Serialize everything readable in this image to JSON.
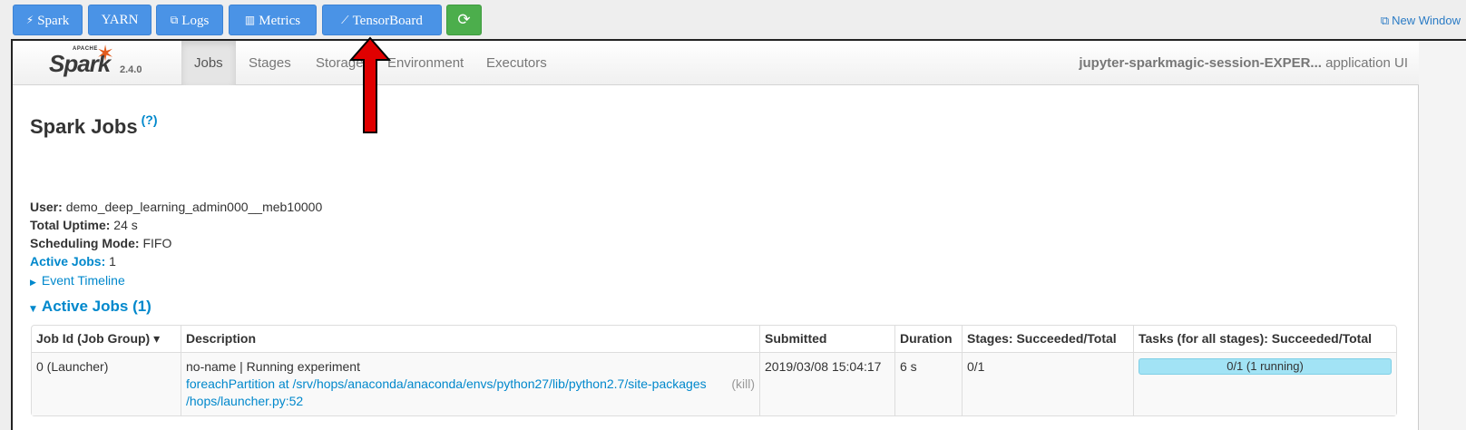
{
  "toolbar": {
    "buttons": [
      {
        "label": "Spark",
        "icon": "bolt-icon"
      },
      {
        "label": "YARN",
        "icon": ""
      },
      {
        "label": "Logs",
        "icon": "copy-icon"
      },
      {
        "label": "Metrics",
        "icon": "bar-chart-icon"
      },
      {
        "label": "TensorBoard",
        "icon": "line-chart-icon"
      },
      {
        "label": "",
        "icon": "refresh-icon"
      }
    ],
    "new_window": "New Window"
  },
  "navbar": {
    "logo_apache": "APACHE",
    "logo_spark": "Spark",
    "version": "2.4.0",
    "tabs": [
      "Jobs",
      "Stages",
      "Storage",
      "Environment",
      "Executors"
    ],
    "active_tab": "Jobs",
    "app_name": "jupyter-sparkmagic-session-EXPER...",
    "app_suffix": "application UI"
  },
  "page": {
    "title": "Spark Jobs",
    "help": "(?)",
    "summary": {
      "user_label": "User:",
      "user": "demo_deep_learning_admin000__meb10000",
      "uptime_label": "Total Uptime:",
      "uptime": "24 s",
      "mode_label": "Scheduling Mode:",
      "mode": "FIFO",
      "active_label": "Active Jobs:",
      "active": "1"
    },
    "event_timeline": "Event Timeline",
    "active_section": "Active Jobs (1)"
  },
  "table": {
    "headers": [
      "Job Id (Job Group) ▾",
      "Description",
      "Submitted",
      "Duration",
      "Stages: Succeeded/Total",
      "Tasks (for all stages): Succeeded/Total"
    ],
    "rows": [
      {
        "job_id": "0 (Launcher)",
        "desc_text": "no-name | Running experiment",
        "desc_link_1": "foreachPartition at /srv/hops/anaconda/anaconda/envs/python27/lib/python2.7/site-packages",
        "desc_link_2": "/hops/launcher.py:52",
        "kill": "(kill)",
        "submitted": "2019/03/08 15:04:17",
        "duration": "6 s",
        "stages": "0/1",
        "tasks": "0/1 (1 running)"
      }
    ]
  },
  "colors": {
    "toolbar_button": "#4a93e6",
    "refresh_button": "#4cae4c",
    "link": "#0088cc",
    "progress": "#a2e3f5",
    "arrow": "#e00000"
  }
}
